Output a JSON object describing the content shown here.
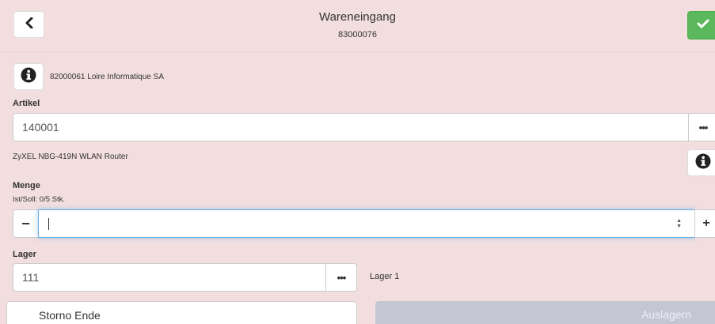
{
  "header": {
    "title": "Wareneingang",
    "subtitle": "83000076"
  },
  "supplier": {
    "text": "82000061 Loire Informatique SA"
  },
  "artikel": {
    "label": "Artikel",
    "value": "140001",
    "description": "ZyXEL NBG-419N WLAN Router",
    "more_label": "•••"
  },
  "menge": {
    "label": "Menge",
    "ist_soll": "Ist/Soll: 0/5 Stk.",
    "value": "",
    "minus_label": "−",
    "plus_label": "+"
  },
  "lager": {
    "label": "Lager",
    "value": "111",
    "name": "Lager 1",
    "more_label": "•••"
  },
  "footer": {
    "storno_label": "Storno Ende",
    "auslagern_label": "Auslagern"
  },
  "colors": {
    "background": "#f2dede",
    "confirm": "#5cb85c",
    "disabled_button": "#c5c5d3",
    "focus": "#66afe9"
  },
  "icons": {
    "back": "chevron-left-icon",
    "confirm": "check-icon",
    "info": "info-circle-icon",
    "more": "ellipsis-icon",
    "spinner": "spinner-arrows-icon"
  }
}
